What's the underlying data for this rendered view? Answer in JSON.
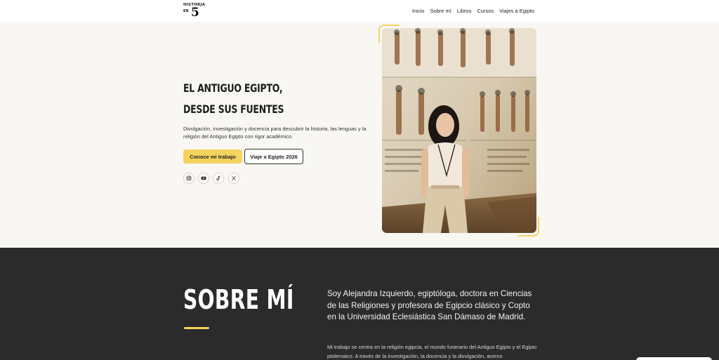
{
  "header": {
    "logo": {
      "top": "HISTORIA",
      "en": "EN",
      "num": "5",
      "deg": "'"
    },
    "nav": [
      "Inicio",
      "Sobre mí",
      "Libros",
      "Cursos",
      "Viajes a Egipto"
    ]
  },
  "hero": {
    "title_line1": "EL ANTIGUO EGIPTO,",
    "title_line2": "DESDE SUS FUENTES",
    "description": "Divulgación, investigación y docencia para descubrir la historia, las lenguas y la religión del Antiguo Egipto con rigor académico.",
    "primary_button": "Conoce mi trabajo",
    "secondary_button": "Viaje a Egipto 2026",
    "social_icons": [
      "instagram-icon",
      "youtube-icon",
      "tiktok-icon",
      "x-icon"
    ]
  },
  "about": {
    "title": "SOBRE MÍ",
    "lead": "Soy Alejandra Izquierdo, egiptóloga, doctora en Ciencias de las Religiones y profesora de Egipcio clásico y Copto en la Universidad Eclesiástica San Dámaso de Madrid.",
    "body": "Mi trabajo se centra en la religión egipcia, el mundo funerario del Antiguo Egipto y el Egipto ptolemaico. A través de la investigación, la docencia y la divulgación, acerco"
  },
  "colors": {
    "accent": "#f4d35e",
    "dark": "#2b2b2b",
    "hero_bg": "#f9f7f3"
  }
}
